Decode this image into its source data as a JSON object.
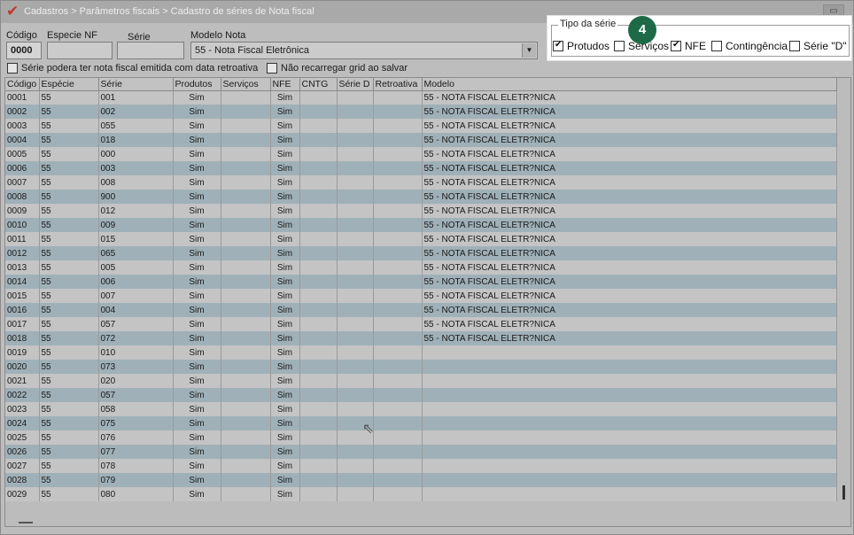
{
  "title": "Cadastros > Parâmetros fiscais > Cadastro de séries de Nota fiscal",
  "close_glyph": "▭",
  "form": {
    "codigo_label": "Código",
    "codigo_value": "0000",
    "especie_label": "Especie NF",
    "especie_value": "",
    "serie_label": "Série",
    "serie_value": "",
    "modelo_label": "Modelo Nota",
    "modelo_value": "55 - Nota Fiscal Eletrônica",
    "chk_retroativa": "Série podera ter nota fiscal emitida com data retroativa",
    "chk_retroativa_checked": false,
    "chk_nao_recarregar": "Não recarregar grid ao salvar",
    "chk_nao_recarregar_checked": false
  },
  "series_type": {
    "legend": "Tipo da série",
    "badge": "4",
    "options": [
      {
        "label": "Protudos",
        "checked": true
      },
      {
        "label": "Serviços",
        "checked": false
      },
      {
        "label": "NFE",
        "checked": true
      },
      {
        "label": "Contingência",
        "checked": false
      },
      {
        "label": "Série \"D\"",
        "checked": false
      }
    ]
  },
  "grid": {
    "columns": [
      "Código",
      "Espécie",
      "Série",
      "Produtos",
      "Serviços",
      "NFE",
      "CNTG",
      "Série D",
      "Retroativa",
      "Modelo"
    ],
    "rows": [
      [
        "0001",
        "55",
        "001",
        "Sim",
        "",
        "Sim",
        "",
        "",
        "",
        "55 - NOTA FISCAL ELETR?NICA"
      ],
      [
        "0002",
        "55",
        "002",
        "Sim",
        "",
        "Sim",
        "",
        "",
        "",
        "55 - NOTA FISCAL ELETR?NICA"
      ],
      [
        "0003",
        "55",
        "055",
        "Sim",
        "",
        "Sim",
        "",
        "",
        "",
        "55 - NOTA FISCAL ELETR?NICA"
      ],
      [
        "0004",
        "55",
        "018",
        "Sim",
        "",
        "Sim",
        "",
        "",
        "",
        "55 - NOTA FISCAL ELETR?NICA"
      ],
      [
        "0005",
        "55",
        "000",
        "Sim",
        "",
        "Sim",
        "",
        "",
        "",
        "55 - NOTA FISCAL ELETR?NICA"
      ],
      [
        "0006",
        "55",
        "003",
        "Sim",
        "",
        "Sim",
        "",
        "",
        "",
        "55 - NOTA FISCAL ELETR?NICA"
      ],
      [
        "0007",
        "55",
        "008",
        "Sim",
        "",
        "Sim",
        "",
        "",
        "",
        "55 - NOTA FISCAL ELETR?NICA"
      ],
      [
        "0008",
        "55",
        "900",
        "Sim",
        "",
        "Sim",
        "",
        "",
        "",
        "55 - NOTA FISCAL ELETR?NICA"
      ],
      [
        "0009",
        "55",
        "012",
        "Sim",
        "",
        "Sim",
        "",
        "",
        "",
        "55 - NOTA FISCAL ELETR?NICA"
      ],
      [
        "0010",
        "55",
        "009",
        "Sim",
        "",
        "Sim",
        "",
        "",
        "",
        "55 - NOTA FISCAL ELETR?NICA"
      ],
      [
        "0011",
        "55",
        "015",
        "Sim",
        "",
        "Sim",
        "",
        "",
        "",
        "55 - NOTA FISCAL ELETR?NICA"
      ],
      [
        "0012",
        "55",
        "065",
        "Sim",
        "",
        "Sim",
        "",
        "",
        "",
        "55 - NOTA FISCAL ELETR?NICA"
      ],
      [
        "0013",
        "55",
        "005",
        "Sim",
        "",
        "Sim",
        "",
        "",
        "",
        "55 - NOTA FISCAL ELETR?NICA"
      ],
      [
        "0014",
        "55",
        "006",
        "Sim",
        "",
        "Sim",
        "",
        "",
        "",
        "55 - NOTA FISCAL ELETR?NICA"
      ],
      [
        "0015",
        "55",
        "007",
        "Sim",
        "",
        "Sim",
        "",
        "",
        "",
        "55 - NOTA FISCAL ELETR?NICA"
      ],
      [
        "0016",
        "55",
        "004",
        "Sim",
        "",
        "Sim",
        "",
        "",
        "",
        "55 - NOTA FISCAL ELETR?NICA"
      ],
      [
        "0017",
        "55",
        "057",
        "Sim",
        "",
        "Sim",
        "",
        "",
        "",
        "55 - NOTA FISCAL ELETR?NICA"
      ],
      [
        "0018",
        "55",
        "072",
        "Sim",
        "",
        "Sim",
        "",
        "",
        "",
        "55 - NOTA FISCAL ELETR?NICA"
      ],
      [
        "0019",
        "55",
        "010",
        "Sim",
        "",
        "Sim",
        "",
        "",
        "",
        ""
      ],
      [
        "0020",
        "55",
        "073",
        "Sim",
        "",
        "Sim",
        "",
        "",
        "",
        ""
      ],
      [
        "0021",
        "55",
        "020",
        "Sim",
        "",
        "Sim",
        "",
        "",
        "",
        ""
      ],
      [
        "0022",
        "55",
        "057",
        "Sim",
        "",
        "Sim",
        "",
        "",
        "",
        ""
      ],
      [
        "0023",
        "55",
        "058",
        "Sim",
        "",
        "Sim",
        "",
        "",
        "",
        ""
      ],
      [
        "0024",
        "55",
        "075",
        "Sim",
        "",
        "Sim",
        "",
        "",
        "",
        ""
      ],
      [
        "0025",
        "55",
        "076",
        "Sim",
        "",
        "Sim",
        "",
        "",
        "",
        ""
      ],
      [
        "0026",
        "55",
        "077",
        "Sim",
        "",
        "Sim",
        "",
        "",
        "",
        ""
      ],
      [
        "0027",
        "55",
        "078",
        "Sim",
        "",
        "Sim",
        "",
        "",
        "",
        ""
      ],
      [
        "0028",
        "55",
        "079",
        "Sim",
        "",
        "Sim",
        "",
        "",
        "",
        ""
      ],
      [
        "0029",
        "55",
        "080",
        "Sim",
        "",
        "Sim",
        "",
        "",
        "",
        ""
      ]
    ]
  }
}
